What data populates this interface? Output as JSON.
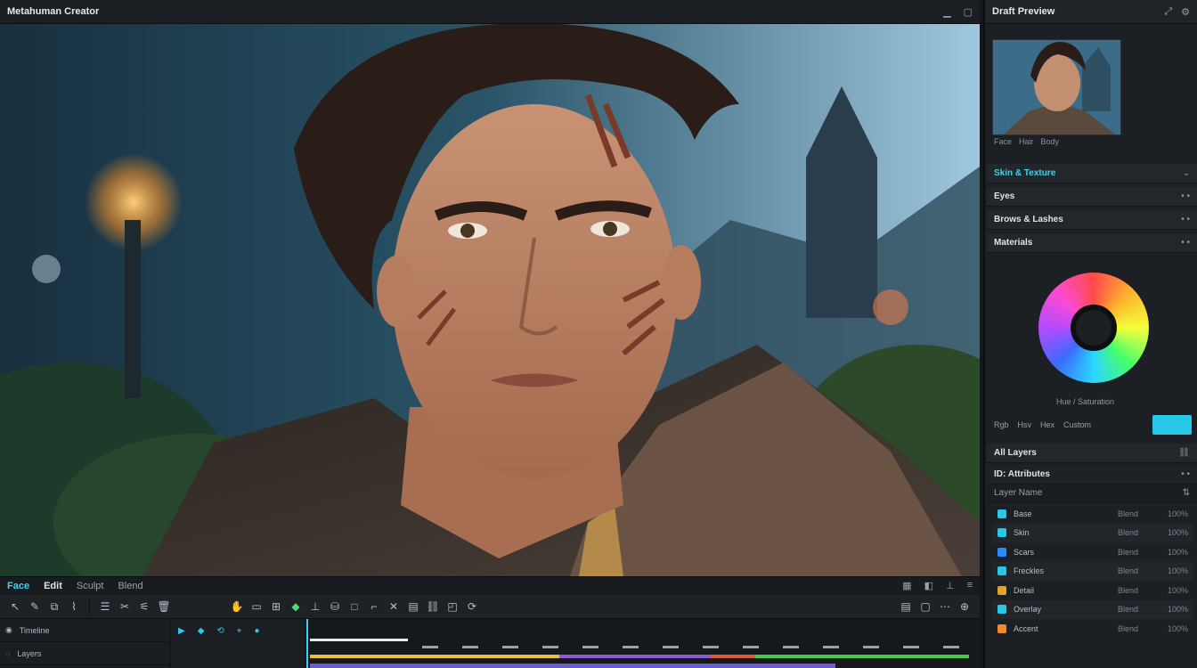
{
  "window": {
    "title": "Metahuman Creator"
  },
  "titlebar_icons": [
    "minimize-icon",
    "maximize-icon"
  ],
  "right_panel": {
    "header_title": "Draft Preview",
    "thumb_caption": [
      "Face",
      "Hair",
      "Body"
    ],
    "sections": [
      {
        "label": "Skin & Texture",
        "accent": true
      },
      {
        "label": "Eyes",
        "accent": false
      },
      {
        "label": "Brows & Lashes",
        "accent": false
      },
      {
        "label": "Materials",
        "accent": false
      }
    ],
    "wheel_caption": "Hue / Saturation",
    "buttons": [
      "Rgb",
      "Hsv",
      "Hex",
      "Custom"
    ],
    "layers_header": "All Layers",
    "layers_sub": "ID: Attributes",
    "layers_col": "Layer Name",
    "layers": [
      {
        "name": "Base",
        "mid": "Blend",
        "end": "100%",
        "color": "#27c8e8"
      },
      {
        "name": "Skin",
        "mid": "Blend",
        "end": "100%",
        "color": "#27c8e8"
      },
      {
        "name": "Scars",
        "mid": "Blend",
        "end": "100%",
        "color": "#2a8bff"
      },
      {
        "name": "Freckles",
        "mid": "Blend",
        "end": "100%",
        "color": "#27c8e8"
      },
      {
        "name": "Detail",
        "mid": "Blend",
        "end": "100%",
        "color": "#e0a52b"
      },
      {
        "name": "Overlay",
        "mid": "Blend",
        "end": "100%",
        "color": "#27c8e8"
      },
      {
        "name": "Accent",
        "mid": "Blend",
        "end": "100%",
        "color": "#f08a2a"
      }
    ]
  },
  "bottom_bar": {
    "mode_a": "Face",
    "mode_b": "Edit",
    "mode_c": "Sculpt",
    "mode_d": "Blend"
  },
  "timeline": {
    "left_rows": [
      "Timeline",
      "Layers"
    ],
    "playhead_pct": 0.0
  }
}
